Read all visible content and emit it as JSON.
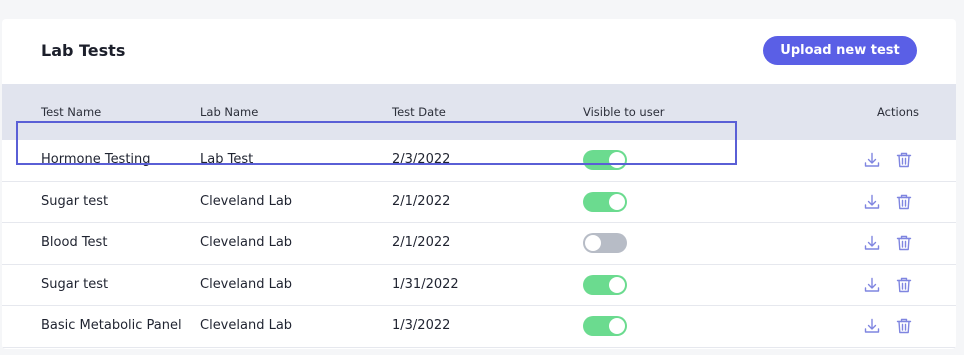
{
  "header": {
    "title": "Lab Tests",
    "upload_label": "Upload new test"
  },
  "columns": {
    "test_name": "Test Name",
    "lab_name": "Lab Name",
    "test_date": "Test Date",
    "visible": "Visible to user",
    "actions": "Actions"
  },
  "rows": [
    {
      "test_name": "Hormone Testing",
      "lab_name": "Lab Test",
      "test_date": "2/3/2022",
      "visible": true
    },
    {
      "test_name": "Sugar test",
      "lab_name": "Cleveland Lab",
      "test_date": "2/1/2022",
      "visible": true
    },
    {
      "test_name": "Blood Test",
      "lab_name": "Cleveland Lab",
      "test_date": "2/1/2022",
      "visible": false
    },
    {
      "test_name": "Sugar test",
      "lab_name": "Cleveland Lab",
      "test_date": "1/31/2022",
      "visible": true
    },
    {
      "test_name": "Basic Metabolic Panel",
      "lab_name": "Cleveland Lab",
      "test_date": "1/3/2022",
      "visible": true
    }
  ],
  "icons": {
    "download": "download-icon",
    "delete": "trash-icon"
  },
  "colors": {
    "accent": "#5a5fe6",
    "toggle_on": "#6bdb8f",
    "toggle_off": "#b7bcc6",
    "header_bg": "#e1e4ee",
    "action_icon": "#7f85e0",
    "selection_outline": "#5a5fd6"
  }
}
